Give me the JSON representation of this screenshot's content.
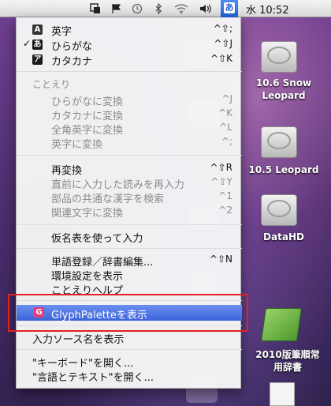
{
  "menubar": {
    "clock": "水 10:52",
    "ime_glyph": "あ",
    "icons": [
      "window-icon",
      "flag-icon",
      "time-machine-icon",
      "bluetooth-icon",
      "wifi-icon"
    ]
  },
  "menu": {
    "modes": [
      {
        "badge": "A",
        "badge_color": "#333333",
        "label": "英字",
        "shortcut": "^⇧;",
        "checked": false
      },
      {
        "badge": "あ",
        "badge_color": "#1a1a1a",
        "label": "ひらがな",
        "shortcut": "^⇧J",
        "checked": true
      },
      {
        "badge": "ア",
        "badge_color": "#1a1a1a",
        "label": "カタカナ",
        "shortcut": "^⇧K",
        "checked": false
      }
    ],
    "check_mark": "✓",
    "kotoeri_header": "ことえり",
    "convert_items": [
      {
        "label": "ひらがなに変換",
        "shortcut": "^J"
      },
      {
        "label": "カタカナに変換",
        "shortcut": "^K"
      },
      {
        "label": "全角英字に変換",
        "shortcut": "^L"
      },
      {
        "label": "英字に変換",
        "shortcut": "^;"
      }
    ],
    "reconvert": {
      "label": "再変換",
      "shortcut": "^⇧R"
    },
    "reconvert_disabled": [
      {
        "label": "直前に入力した読みを再入力",
        "shortcut": "^⇧Y"
      },
      {
        "label": "部品の共通な漢字を検索",
        "shortcut": "^1"
      },
      {
        "label": "関連文字に変換",
        "shortcut": "^2"
      }
    ],
    "kana_table": "仮名表を使って入力",
    "dictionary": {
      "label": "単語登録／辞書編集...",
      "shortcut": "^⇧N"
    },
    "preferences": "環境設定を表示",
    "help": "ことえりヘルプ",
    "glyph_palette": "GlyphPaletteを表示",
    "glyph_badge": "G",
    "show_input_source": "入力ソース名を表示",
    "open_keyboard": "\"キーボード\"を開く...",
    "open_language_text": "\"言語とテキスト\"を開く..."
  },
  "desktop": {
    "icons": [
      {
        "label_line1": "10.6 Snow",
        "label_line2": "Leopard"
      },
      {
        "label_line1": "10.5 Leopard",
        "label_line2": ""
      },
      {
        "label_line1": "DataHD",
        "label_line2": ""
      },
      {
        "label_line1": "2010版筆順常",
        "label_line2": "用辞書"
      }
    ]
  },
  "colors": {
    "highlight": "#3c63d9",
    "annotation_box": "#e32020",
    "glyph_badge": "#e0407a"
  }
}
